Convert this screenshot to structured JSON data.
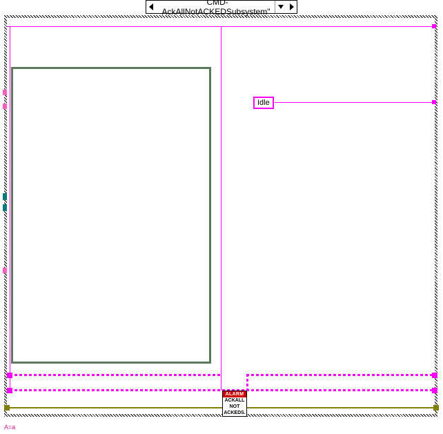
{
  "case": {
    "label": "\"CMD-AckAllNotACKEDSubsystem\""
  },
  "constants": {
    "idle": "Idle"
  },
  "nodes": {
    "ackAll": {
      "header": "ALARM",
      "line1": "ACKALL",
      "line2": "NOT",
      "line3": "ACKEDS."
    }
  },
  "labels": {
    "bottom": "A=a"
  },
  "colors": {
    "pink": "#ff00ff",
    "olive": "#808000",
    "cluster": "#5a7a5a"
  }
}
